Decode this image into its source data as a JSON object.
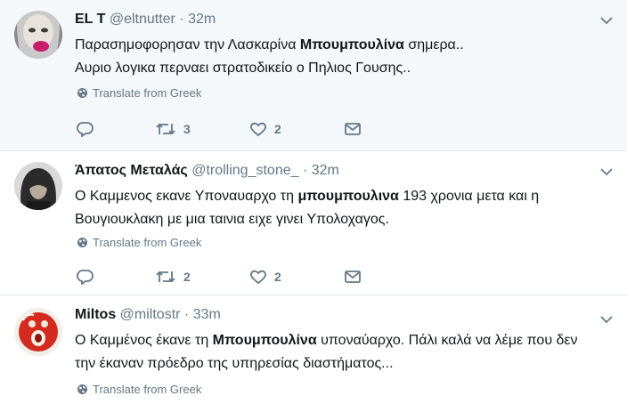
{
  "tweets": [
    {
      "fullname": "EL T",
      "handle": "@eltnutter",
      "separator": "·",
      "time": "32m",
      "line1_pre": "Παρασημοφορησαν την Λασκαρίνα ",
      "line1_bold": "Μπουμπουλίνα",
      "line1_post": " σημερα..",
      "line2_pre": "Αυριο λογικα περναει στρατοδικείο ο Πηλιος Γουσης..",
      "line2_bold": "",
      "line2_post": "",
      "translate_label": "Translate from Greek",
      "reply_count": "",
      "retweet_count": "3",
      "like_count": "2",
      "icons": {
        "reply": "reply-icon",
        "retweet": "retweet-icon",
        "like": "heart-icon",
        "dm": "envelope-icon",
        "caret": "chevron-down-icon",
        "globe": "globe-icon"
      }
    },
    {
      "fullname": "Άπατος Μεταλάς",
      "handle": "@trolling_stone_",
      "separator": "·",
      "time": "32m",
      "line1_pre": "Ο Καμμενος εκανε Υποναυαρχο τη ",
      "line1_bold": "μπουμπουλινα",
      "line1_post": " 193 χρονια μετα και η",
      "line2_pre": "Βουγιουκλακη με μια ταινια ειχε γινει Υπολοχαγος.",
      "line2_bold": "",
      "line2_post": "",
      "translate_label": "Translate from Greek",
      "reply_count": "",
      "retweet_count": "2",
      "like_count": "2"
    },
    {
      "fullname": "Miltos",
      "handle": "@miltostr",
      "separator": "·",
      "time": "33m",
      "line1_pre": "Ο Καμμένος έκανε τη ",
      "line1_bold": "Μπουμπουλίνα",
      "line1_post": " υποναύαρχο. Πάλι καλά να λέμε που δεν",
      "line2_pre": "την έκαναν πρόεδρο της υπηρεσίας διαστήματος...",
      "line2_bold": "",
      "line2_post": "",
      "translate_label": "Translate from Greek"
    }
  ],
  "colors": {
    "secondary_text": "#657786",
    "primary_text": "#14171a",
    "highlight_bg": "#f5f8fa",
    "divider": "#e1e8ed"
  }
}
